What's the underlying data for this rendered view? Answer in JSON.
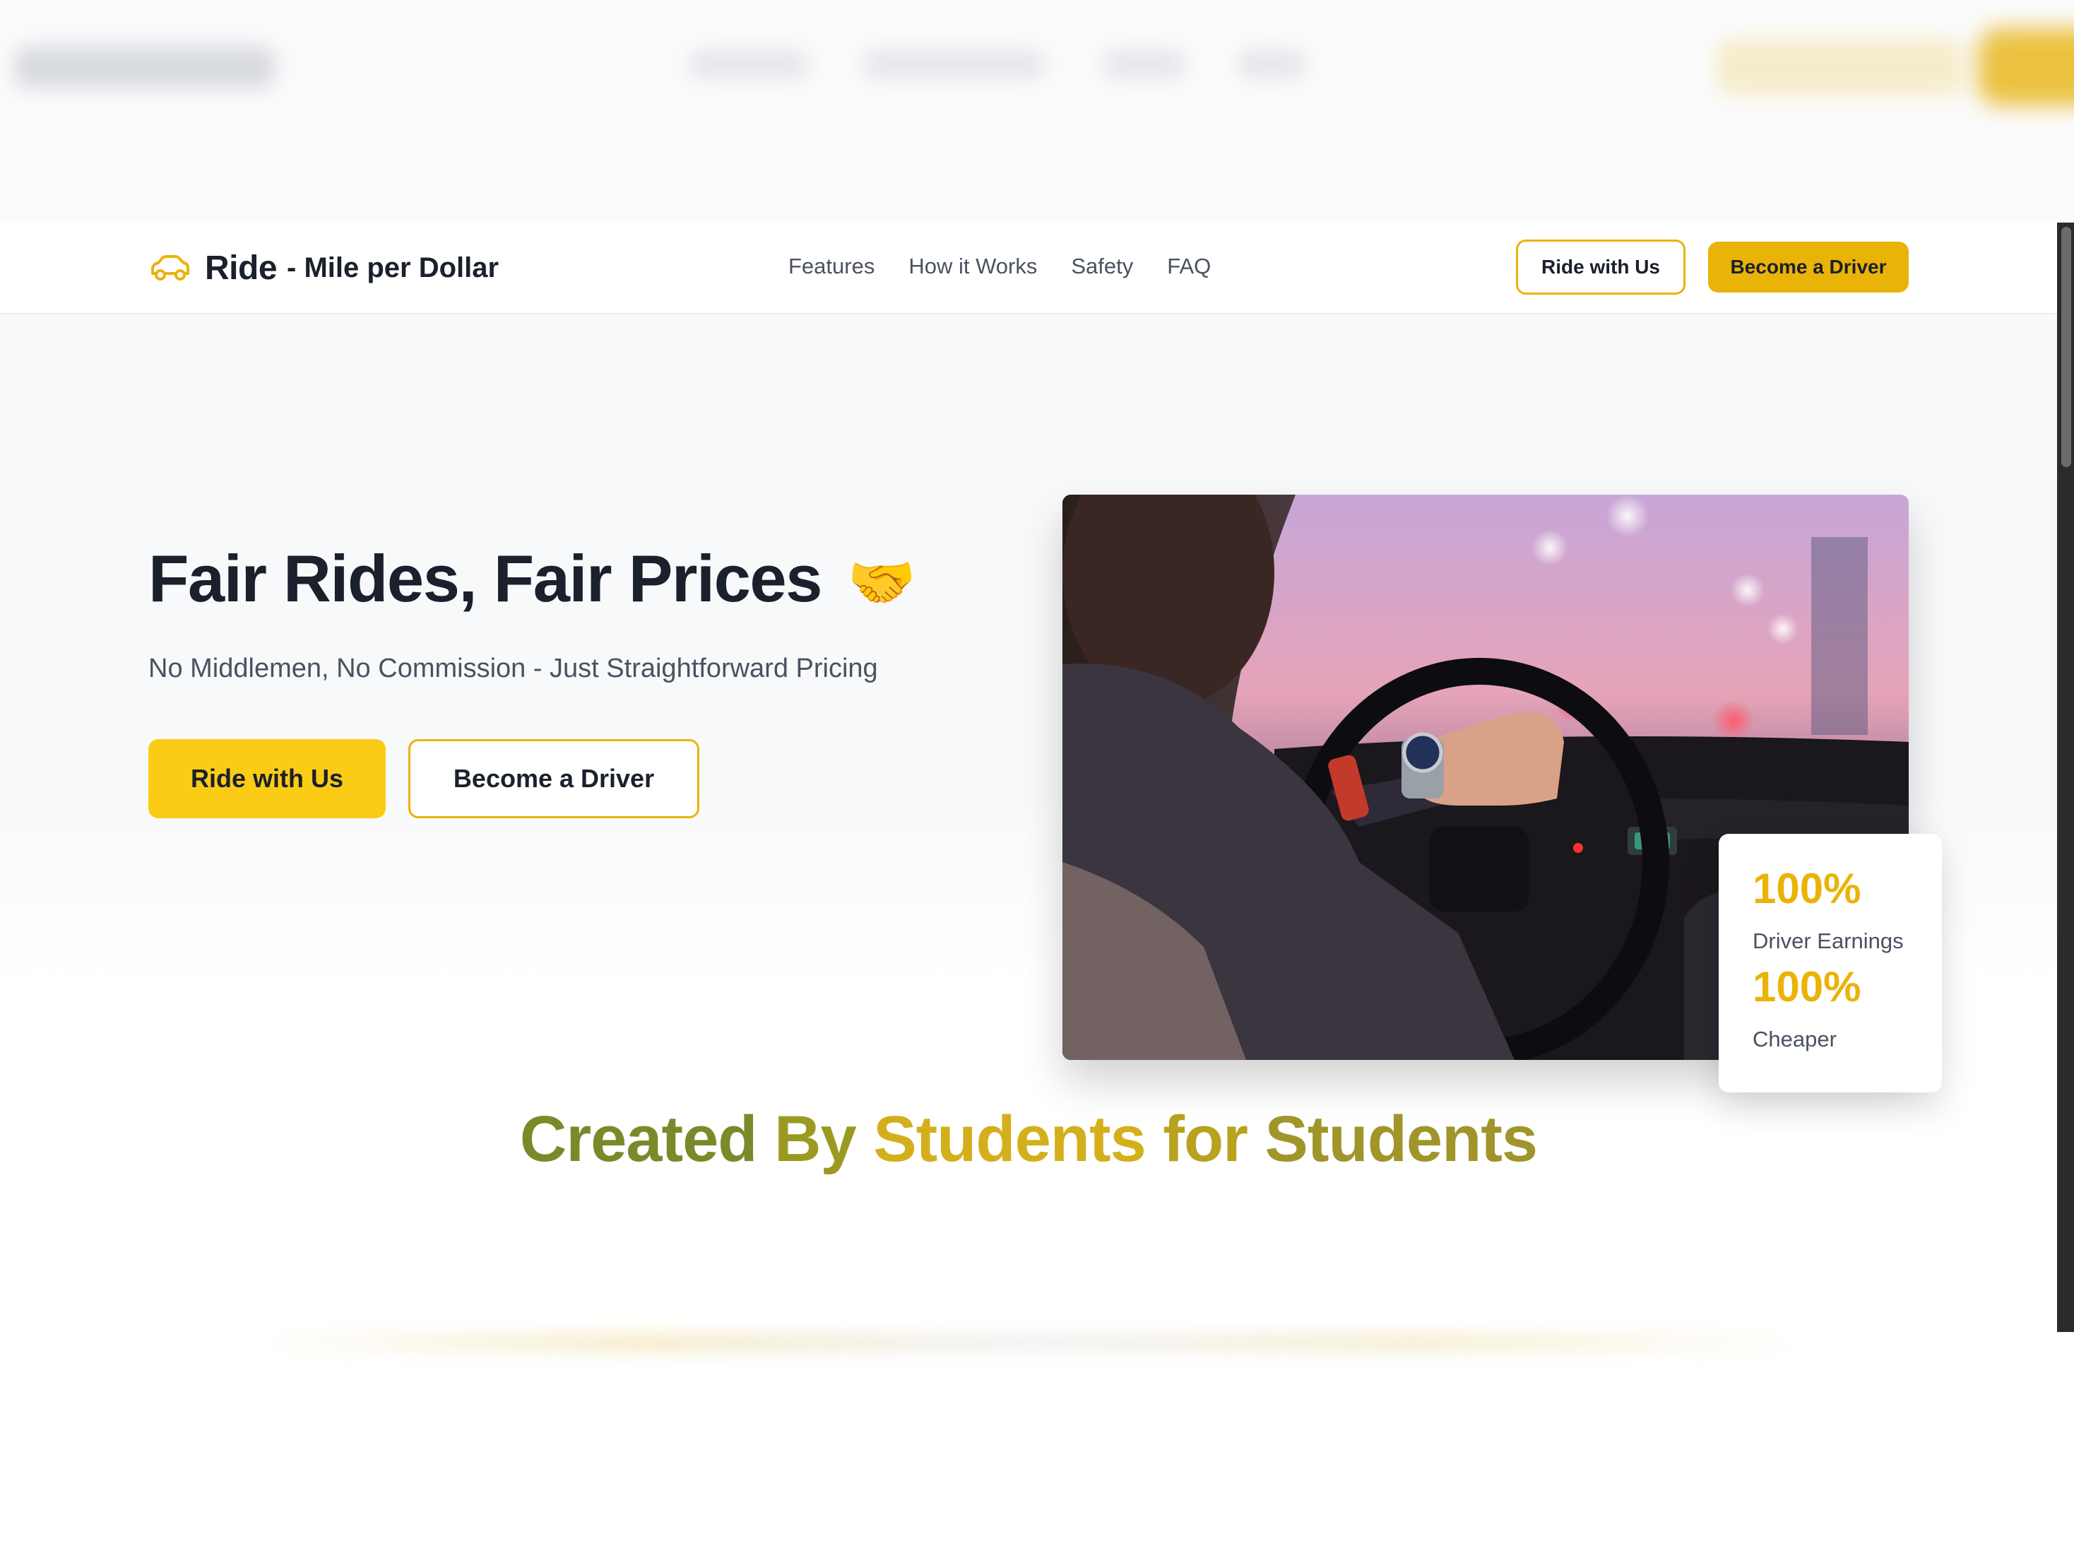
{
  "brand": {
    "name": "Ride",
    "tagline": "- Mile per Dollar",
    "icon": "car-icon",
    "accent": "#eab308"
  },
  "nav": {
    "links": [
      {
        "label": "Features"
      },
      {
        "label": "How it Works"
      },
      {
        "label": "Safety"
      },
      {
        "label": "FAQ"
      }
    ],
    "ride_button": "Ride with Us",
    "driver_button": "Become a Driver"
  },
  "hero": {
    "title": "Fair Rides, Fair Prices",
    "title_emoji": "🤝",
    "subtitle": "No Middlemen, No Commission - Just Straightforward Pricing",
    "primary_button": "Ride with Us",
    "secondary_button": "Become a Driver"
  },
  "stats": [
    {
      "value": "100%",
      "label": "Driver Earnings"
    },
    {
      "value": "100%",
      "label": "Cheaper"
    }
  ],
  "tagline": {
    "words": [
      {
        "text": "Created",
        "color": "#7a8a2a"
      },
      {
        "text": "By",
        "color": "#9a9a22"
      },
      {
        "text": "Students",
        "color": "#d4af1c"
      },
      {
        "text": "for",
        "color": "#b8a21e"
      },
      {
        "text": "Students",
        "color": "#a0952a"
      }
    ]
  },
  "colors": {
    "accent": "#eab308",
    "accent_light": "#facc15",
    "text": "#1a202c",
    "muted": "#4a5260"
  }
}
